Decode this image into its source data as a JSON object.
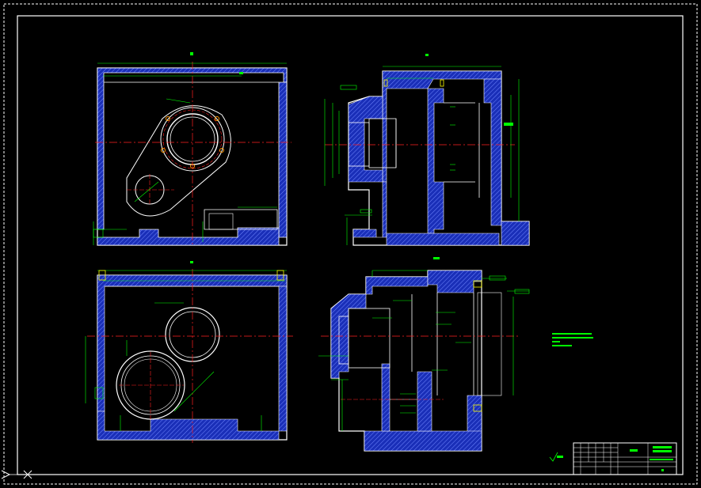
{
  "drawing": {
    "background": "#000000",
    "colors": {
      "outline": "#ffffff",
      "section_fill": "#1a2fb8",
      "centerline": "#ff2020",
      "dimension": "#00ff00",
      "hidden_detail": "#ffff00"
    },
    "views": [
      "top-view",
      "front-section-view",
      "bottom-view",
      "side-section-view"
    ],
    "tech_notes_label": "",
    "title_block": {
      "part_name": "",
      "scale": "",
      "material": "",
      "sheet": ""
    },
    "ucs_icon": "ucs-axis-icon"
  }
}
